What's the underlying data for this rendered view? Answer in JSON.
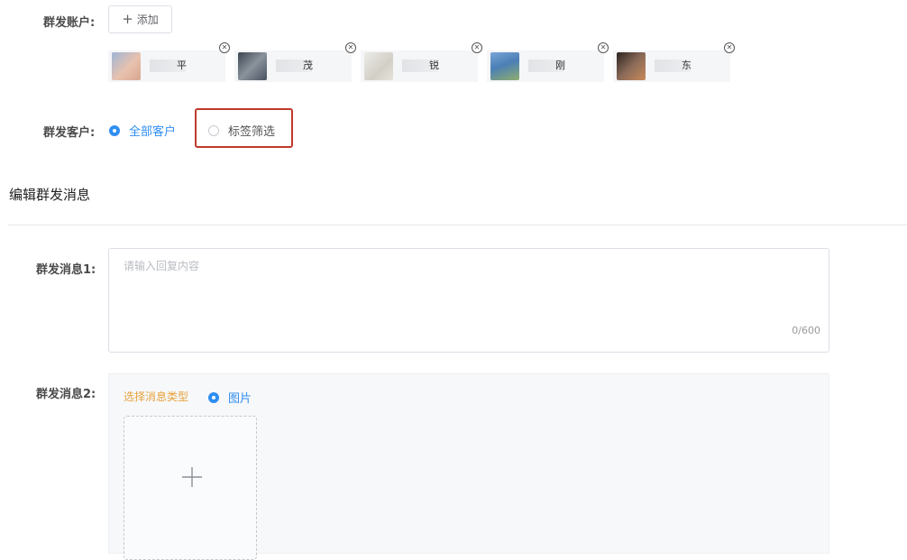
{
  "form": {
    "account_label": "群发账户:",
    "add_label": "添加",
    "accounts": [
      {
        "name": "平",
        "avatar_color": "#d9b8a8"
      },
      {
        "name": "茂",
        "avatar_color": "#5b6470"
      },
      {
        "name": "锐",
        "avatar_color": "#d7d5cf"
      },
      {
        "name": "刚",
        "avatar_color": "#6b90b8"
      },
      {
        "name": "东",
        "avatar_color": "#6e5a4c"
      }
    ],
    "customer_label": "群发客户:",
    "customer_options": [
      "全部客户",
      "标签筛选"
    ],
    "selected_customer_option": "全部客户"
  },
  "message_section": {
    "title": "编辑群发消息",
    "msg1_label": "群发消息1:",
    "msg1_placeholder": "请输入回复内容",
    "msg1_counter": "0/600",
    "msg2_label": "群发消息2:",
    "msg2_type_label": "选择消息类型",
    "msg2_type_option": "图片"
  },
  "colors": {
    "accent": "#2f8ef3",
    "highlight": "#c0392b",
    "warning_text": "#e6a23c"
  }
}
